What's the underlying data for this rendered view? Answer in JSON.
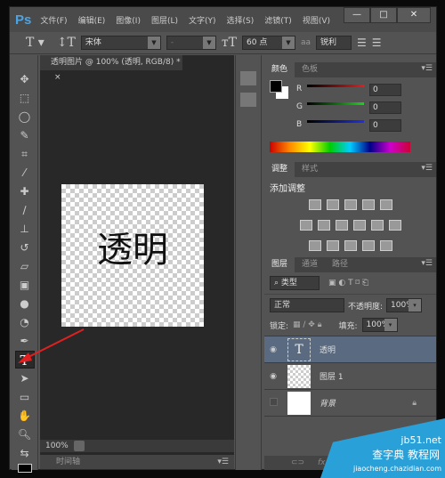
{
  "app": {
    "logo": "Ps",
    "menus": [
      "文件(F)",
      "编辑(E)",
      "图像(I)",
      "图层(L)",
      "文字(Y)",
      "选择(S)",
      "滤镜(T)",
      "视图(V)"
    ],
    "window_buttons": [
      "—",
      "□",
      "✕"
    ]
  },
  "options": {
    "font_family": "宋体",
    "font_style": "-",
    "font_size": "60 点",
    "antialias": "锐利",
    "antialias_label": "aa"
  },
  "document": {
    "tab_title": "透明图片 @ 100% (透明, RGB/8) *",
    "close": "×",
    "canvas_text": "透明",
    "zoom": "100%",
    "timeline_tab": "时间轴"
  },
  "color_panel": {
    "tabs": [
      "颜色",
      "色板"
    ],
    "channels": [
      {
        "label": "R",
        "value": "0",
        "color": "#e02020"
      },
      {
        "label": "G",
        "value": "0",
        "color": "#20d020"
      },
      {
        "label": "B",
        "value": "0",
        "color": "#2030e0"
      }
    ],
    "foreground": "#000000",
    "background": "#ffffff"
  },
  "adjust_panel": {
    "tabs": [
      "调整",
      "样式"
    ],
    "title": "添加调整"
  },
  "layers_panel": {
    "tabs": [
      "图层",
      "通道",
      "路径"
    ],
    "filter_kind": "类型",
    "blend_mode": "正常",
    "opacity_label": "不透明度:",
    "opacity": "100%",
    "lock_label": "锁定:",
    "fill_label": "填充:",
    "fill": "100%",
    "layers": [
      {
        "name": "透明",
        "type": "text",
        "visible": true,
        "selected": true
      },
      {
        "name": "图层 1",
        "type": "transparent",
        "visible": true,
        "selected": false
      },
      {
        "name": "背景",
        "type": "white",
        "visible": false,
        "selected": false,
        "locked": true
      }
    ],
    "footer_icons": [
      "link-icon",
      "fx-icon"
    ],
    "fx": "fx"
  },
  "watermark": {
    "site": "jb51.net",
    "text": "查字典 教程网",
    "url": "jiaocheng.chazidian.com"
  },
  "accent": "#4fa3e0",
  "selected_layer_color": "#5a6a80"
}
